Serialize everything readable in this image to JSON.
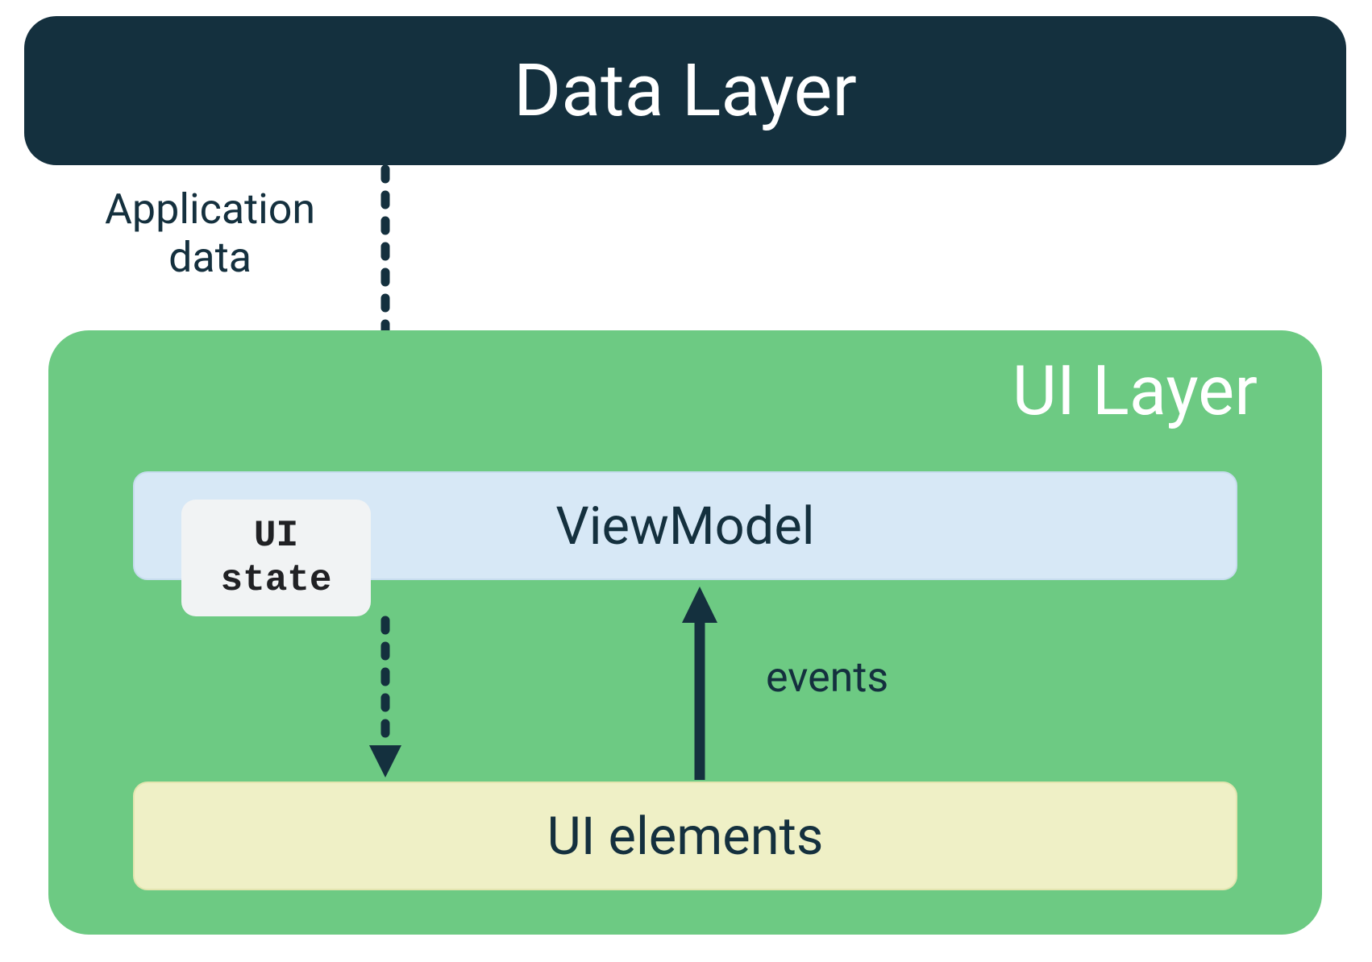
{
  "dataLayer": {
    "title": "Data Layer"
  },
  "arrows": {
    "applicationData": "Application\ndata",
    "events": "events"
  },
  "uiLayer": {
    "title": "UI Layer",
    "viewModel": "ViewModel",
    "uiState": "UI\nstate",
    "uiElements": "UI elements"
  },
  "colors": {
    "darkNavy": "#14303e",
    "green": "#6dca83",
    "lightBlue": "#d7e8f6",
    "lightYellow": "#eff0c6",
    "lightGray": "#f1f3f4"
  }
}
